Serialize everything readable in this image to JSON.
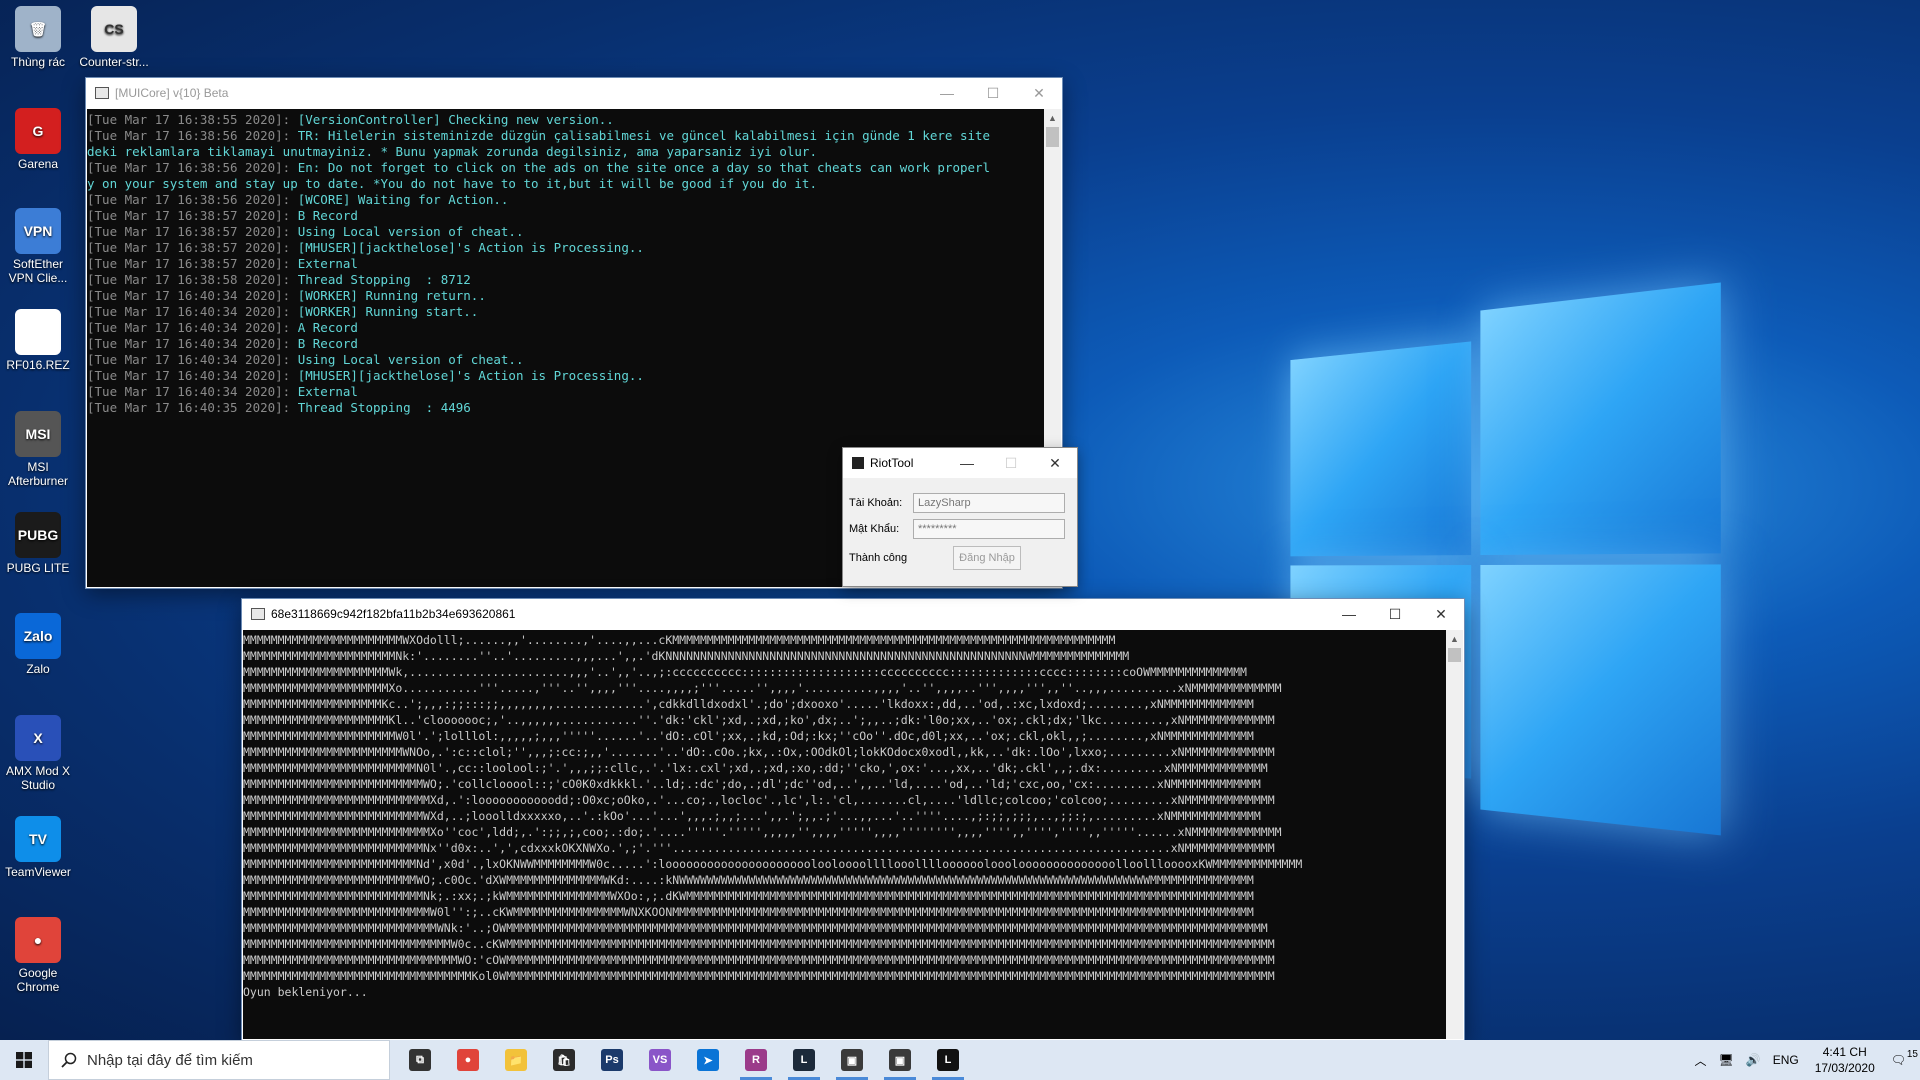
{
  "desktop": {
    "icons": [
      {
        "label": "Thùng rác",
        "glyph": "🗑",
        "color": "#9fb3c9"
      },
      {
        "label": "Counter-str...",
        "glyph": "CS",
        "color": "#e6e6e6"
      },
      {
        "label": "Garena",
        "glyph": "G",
        "color": "#d31f1f"
      },
      {
        "label": "SoftEther VPN Clie...",
        "glyph": "VPN",
        "color": "#3c7dd6"
      },
      {
        "label": "RF016.REZ",
        "glyph": "",
        "color": "#ffffff"
      },
      {
        "label": "MSI Afterburner",
        "glyph": "MSI",
        "color": "#555555"
      },
      {
        "label": "PUBG LITE",
        "glyph": "PUBG",
        "color": "#1b1b1b"
      },
      {
        "label": "Zalo",
        "glyph": "Zalo",
        "color": "#0a68d8"
      },
      {
        "label": "AMX Mod X Studio",
        "glyph": "X",
        "color": "#2950b8"
      },
      {
        "label": "TeamViewer",
        "glyph": "TV",
        "color": "#0e8ee9"
      },
      {
        "label": "Google Chrome",
        "glyph": "●",
        "color": "#e0443a"
      }
    ]
  },
  "console1": {
    "title": "[MUICore] v{10} Beta",
    "lines": [
      {
        "ts": "[Tue Mar 17 16:38:55 2020]: ",
        "msg": "[VersionController] Checking new version.."
      },
      {
        "ts": "[Tue Mar 17 16:38:56 2020]: ",
        "msg": "TR: Hilelerin sisteminizde düzgün çalisabilmesi ve güncel kalabilmesi için günde 1 kere site"
      },
      {
        "ts": "",
        "msg": "deki reklamlara tiklamayi unutmayiniz. * Bunu yapmak zorunda degilsiniz, ama yaparsaniz iyi olur."
      },
      {
        "ts": "[Tue Mar 17 16:38:56 2020]: ",
        "msg": "En: Do not forget to click on the ads on the site once a day so that cheats can work properl"
      },
      {
        "ts": "",
        "msg": "y on your system and stay up to date. *You do not have to to it,but it will be good if you do it."
      },
      {
        "ts": "[Tue Mar 17 16:38:56 2020]: ",
        "msg": "[WCORE] Waiting for Action.."
      },
      {
        "ts": "[Tue Mar 17 16:38:57 2020]: ",
        "msg": "B Record"
      },
      {
        "ts": "[Tue Mar 17 16:38:57 2020]: ",
        "msg": "Using Local version of cheat.."
      },
      {
        "ts": "[Tue Mar 17 16:38:57 2020]: ",
        "msg": "[MHUSER][jackthelose]'s Action is Processing.."
      },
      {
        "ts": "[Tue Mar 17 16:38:57 2020]: ",
        "msg": "External"
      },
      {
        "ts": "[Tue Mar 17 16:38:58 2020]: ",
        "msg": "Thread Stopping  : 8712"
      },
      {
        "ts": "[Tue Mar 17 16:40:34 2020]: ",
        "msg": "[WORKER] Running return.."
      },
      {
        "ts": "[Tue Mar 17 16:40:34 2020]: ",
        "msg": "[WORKER] Running start.."
      },
      {
        "ts": "[Tue Mar 17 16:40:34 2020]: ",
        "msg": "A Record"
      },
      {
        "ts": "[Tue Mar 17 16:40:34 2020]: ",
        "msg": "B Record"
      },
      {
        "ts": "[Tue Mar 17 16:40:34 2020]: ",
        "msg": "Using Local version of cheat.."
      },
      {
        "ts": "[Tue Mar 17 16:40:34 2020]: ",
        "msg": "[MHUSER][jackthelose]'s Action is Processing.."
      },
      {
        "ts": "[Tue Mar 17 16:40:34 2020]: ",
        "msg": "External"
      },
      {
        "ts": "[Tue Mar 17 16:40:35 2020]: ",
        "msg": "Thread Stopping  : 4496"
      }
    ]
  },
  "riot": {
    "title": "RiotTool",
    "account_label": "Tài Khoản:",
    "account_value": "LazySharp",
    "password_label": "Mật Khẩu:",
    "password_value": "*********",
    "status": "Thành công",
    "login_button": "Đăng Nhập"
  },
  "console2": {
    "title": "68e3118669c942f182bfa11b2b34e693620861",
    "art": [
      "MMMMMMMMMMMMMMMMMMMMMMMWXOdolll;......,,'........,'....,,...cKMMMMMMMMMMMMMMMMMMMMMMMMMMMMMMMMMMMMMMMMMMMMMMMMMMMMMMMMMMMMMMMM",
      "MMMMMMMMMMMMMMMMMMMMMMNk:'........''..'.........,,,...',,.'dKNNNNNNNNNNNNNNNNNNNNNNNNNNNNNNNNNNNNNNNNNNNNNNNNNNNNWMMMMMMMMMMMMMM",
      "MMMMMMMMMMMMMMMMMMMMMWk,.......................,,,'..',,'..,;:cccccccccc::::::::::::::::::::cccccccccc:::::::::::::cccc::::::::coOWMMMMMMMMMMMMMM",
      "MMMMMMMMMMMMMMMMMMMMMXo...........'''.....,'''..'',,,,'''....,,,,;'''.....'',,,,'..........,,,,'..'',,,,..''',,,,''',,''..,,,..........xNMMMMMMMMMMMMM",
      "MMMMMMMMMMMMMMMMMMMMKc..';,,,:;;:::;;,,,,,,,,.............',cdkkdlldxodxl'.;do';dxooxo'.....'lkdoxx:,dd,..'od,.:xc,lxdoxd;........,xNMMMMMMMMMMMMM",
      "MMMMMMMMMMMMMMMMMMMMMKl..'clooooooc;,'..,,,,,,...........''.'dk:'ckl';xd,.;xd,;ko',dx;..';,,..;dk:'l0o;xx,..'ox;.ckl;dx;'lkc.........,xNMMMMMMMMMMMMM",
      "MMMMMMMMMMMMMMMMMMMMMMW0l'.';lolllol:,,,,,;,,,'''''......'..'dO:.cOl';xx,.;kd,:Od;:kx;''cOo''.dOc,d0l;xx,..'ox;.ckl,okl,,;........,xNMMMMMMMMMMMMM",
      "MMMMMMMMMMMMMMMMMMMMMMMWNOo,.':c::clol;'',,,;:cc:;,,'.......'..'dO:.cOo.;kx,.:Ox,:OOdkOl;lokKOdocx0xodl,,kk,..'dk:.lOo',lxxo;.........xNMMMMMMMMMMMMM",
      "MMMMMMMMMMMMMMMMMMMMMMMMMN0l'.,cc::loolool:;'.',,,;;:cllc,.'.'lx:.cxl';xd,.;xd,:xo,:dd;''cko,',ox:'...,xx,..'dk;.ckl',,;.dx:.........xNMMMMMMMMMMMMM",
      "MMMMMMMMMMMMMMMMMMMMMMMMMMWO;.'collclooool::;'cO0K0xdkkkl.'..ld;.:dc';do,.;dl';dc''od,..',,..'ld,....'od,..'ld;'cxc,oo,'cx:.........xNMMMMMMMMMMMMM",
      "MMMMMMMMMMMMMMMMMMMMMMMMMMMXd,.':looooooooooodd;:O0xc;oOko,.'...co;.,locloc'.,lc',l:.'cl,.......cl,....'ldllc;colcoo;'colcoo;.........xNMMMMMMMMMMMMM",
      "MMMMMMMMMMMMMMMMMMMMMMMMMMWXd,..;looolldxxxxxo,..'.:kOo'...'...',,,.;,,;...',,.';,,.;'...,,...'..''''....,;:;;,;;;,..,;;:;,.........xNMMMMMMMMMMMMM",
      "MMMMMMMMMMMMMMMMMMMMMMMMMMMXo''coc',ldd;,.':;;,;,coo;.:do;.'....'''''.''''',,,,,'',,,,''''',,,,'''''''',,,,'''',,'''','''',,'''''......xNMMMMMMMMMMMMM",
      "MMMMMMMMMMMMMMMMMMMMMMMMMMNx''d0x:..',',cdxxxkOKXNWXo.',;'.'''........................................................................xNMMMMMMMMMMMMM",
      "MMMMMMMMMMMMMMMMMMMMMMMMMNd',x0d'.,lxOKNWWMMMMMMMMW0c.....':looooooooooooooooooooolooloooollllooollllooooooloooloooooooooooooolloolllooooxKWMMMMMMMMMMMMM",
      "MMMMMMMMMMMMMMMMMMMMMMMMMWO;.c0Oc.'dXWMMMMMMMMMMMMMMWKd:....:kNWWWWWWWWWWWWWWWWWWWWWWWWWWWWWWWWWWWWWWWWWWWWWWWWWWWWWWWWWWWWWWWWWWWWMMMMMMMMMMMMMMM",
      "MMMMMMMMMMMMMMMMMMMMMMMMMMNk;.:xx;.;kWMMMMMMMMMMMMMMMWXOo:,;.dKWMMMMMMMMMMMMMMMMMMMMMMMMMMMMMMMMMMMMMMMMMMMMMMMMMMMMMMMMMMMMMMMMMMMMMMMMMMMMMMMMMM",
      "MMMMMMMMMMMMMMMMMMMMMMMMMMMW0l'':;..cKWMMMMMMMMMMMMMMMMWNXKOONMMMMMMMMMMMMMMMMMMMMMMMMMMMMMMMMMMMMMMMMMMMMMMMMMMMMMMMMMMMMMMMMMMMMMMMMMMMMMMMMMMMM",
      "MMMMMMMMMMMMMMMMMMMMMMMMMMMMWNk:'..;OWMMMMMMMMMMMMMMMMMMMMMMMMMMMMMMMMMMMMMMMMMMMMMMMMMMMMMMMMMMMMMMMMMMMMMMMMMMMMMMMMMMMMMMMMMMMMMMMMMMMMMMMMMMMMMM",
      "MMMMMMMMMMMMMMMMMMMMMMMMMMMMMMW0c..cKWMMMMMMMMMMMMMMMMMMMMMMMMMMMMMMMMMMMMMMMMMMMMMMMMMMMMMMMMMMMMMMMMMMMMMMMMMMMMMMMMMMMMMMMMMMMMMMMMMMMMMMMMMMMMMMM",
      "MMMMMMMMMMMMMMMMMMMMMMMMMMMMMMMWO:'cOWMMMMMMMMMMMMMMMMMMMMMMMMMMMMMMMMMMMMMMMMMMMMMMMMMMMMMMMMMMMMMMMMMMMMMMMMMMMMMMMMMMMMMMMMMMMMMMMMMMMMMMMMMMMMMMM",
      "MMMMMMMMMMMMMMMMMMMMMMMMMMMMMMMMMKol0WMMMMMMMMMMMMMMMMMMMMMMMMMMMMMMMMMMMMMMMMMMMMMMMMMMMMMMMMMMMMMMMMMMMMMMMMMMMMMMMMMMMMMMMMMMMMMMMMMMMMMMMMMMMMMMM"
    ],
    "status_line": "Oyun bekleniyor..."
  },
  "taskbar": {
    "search_placeholder": "Nhập tại đây để tìm kiếm",
    "apps": [
      {
        "name": "task-view",
        "glyph": "⧉",
        "color": "#333333",
        "open": false
      },
      {
        "name": "chrome",
        "glyph": "●",
        "color": "#e0443a",
        "open": false
      },
      {
        "name": "file-explorer",
        "glyph": "📁",
        "color": "#f2c23a",
        "open": false
      },
      {
        "name": "store",
        "glyph": "🛍",
        "color": "#2b2b2b",
        "open": false
      },
      {
        "name": "photoshop",
        "glyph": "Ps",
        "color": "#1b3a6b",
        "open": false
      },
      {
        "name": "visual-studio",
        "glyph": "VS",
        "color": "#8a55c8",
        "open": false
      },
      {
        "name": "pointer-app",
        "glyph": "➤",
        "color": "#0a74d6",
        "open": false
      },
      {
        "name": "winrar",
        "glyph": "R",
        "color": "#9b3b8a",
        "open": true
      },
      {
        "name": "riot-tool",
        "glyph": "L",
        "color": "#1c2a3a",
        "open": true
      },
      {
        "name": "console-a",
        "glyph": "▣",
        "color": "#3a3a3a",
        "open": true
      },
      {
        "name": "console-b",
        "glyph": "▣",
        "color": "#3a3a3a",
        "open": true
      },
      {
        "name": "league",
        "glyph": "L",
        "color": "#111111",
        "open": true
      }
    ],
    "tray": {
      "language": "ENG",
      "time": "4:41 CH",
      "date": "17/03/2020",
      "notifications": "15"
    }
  }
}
